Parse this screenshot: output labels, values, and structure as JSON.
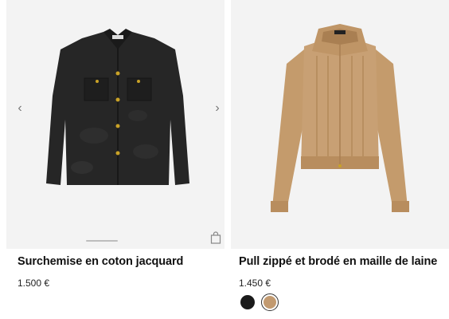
{
  "products": [
    {
      "name": "Surchemise en coton jacquard",
      "price": "1.500 €",
      "image_alt": "black-jacquard-overshirt",
      "colors": [
        "#1c1c1c"
      ]
    },
    {
      "name": "Pull zippé et brodé en maille de laine",
      "price": "1.450 €",
      "image_alt": "camel-cable-knit-zip-sweater",
      "swatches": [
        {
          "color": "#1a1a1a",
          "selected": false
        },
        {
          "color": "#c29a70",
          "selected": true
        }
      ]
    }
  ],
  "icons": {
    "prev": "‹",
    "next": "›",
    "bag": "shopping-bag-icon"
  }
}
